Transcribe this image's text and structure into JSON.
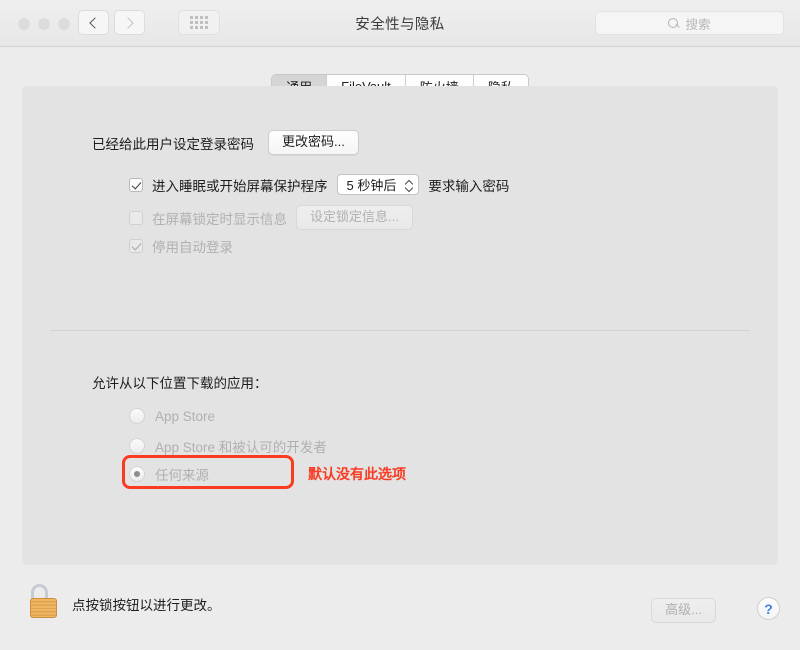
{
  "window": {
    "title": "安全性与隐私",
    "traffic_lights": [
      "close",
      "minimize",
      "zoom"
    ],
    "nav_back": "back-icon",
    "nav_forward": "forward-icon",
    "grid_button": "show-all-icon"
  },
  "search": {
    "placeholder": "搜索",
    "icon": "search-icon",
    "value": ""
  },
  "tabs": [
    {
      "label": "通用",
      "selected": true
    },
    {
      "label": "FileVault",
      "selected": false
    },
    {
      "label": "防火墙",
      "selected": false
    },
    {
      "label": "隐私",
      "selected": false
    }
  ],
  "general": {
    "password_status": "已经给此用户设定登录密码",
    "change_password_button": "更改密码...",
    "require_password": {
      "label": "进入睡眠或开始屏幕保护程序",
      "checked": true,
      "delay_value": "5 秒钟后",
      "suffix": "要求输入密码"
    },
    "lock_message": {
      "label": "在屏幕锁定时显示信息",
      "checked": false,
      "disabled": true,
      "button": "设定锁定信息..."
    },
    "disable_auto_login": {
      "label": "停用自动登录",
      "checked": true,
      "disabled": true
    }
  },
  "download_sources": {
    "heading": "允许从以下位置下载的应用：",
    "options": [
      {
        "label": "App Store",
        "selected": false
      },
      {
        "label": "App Store 和被认可的开发者",
        "selected": false
      },
      {
        "label": "任何来源",
        "selected": true,
        "highlighted": true
      }
    ],
    "annotation": "默认没有此选项",
    "annotation_color": "#f93b22"
  },
  "footer": {
    "lock_icon": "unlocked-padlock-icon",
    "lock_text": "点按锁按钮以进行更改。",
    "advanced_button": "高级...",
    "help_button": "?"
  }
}
